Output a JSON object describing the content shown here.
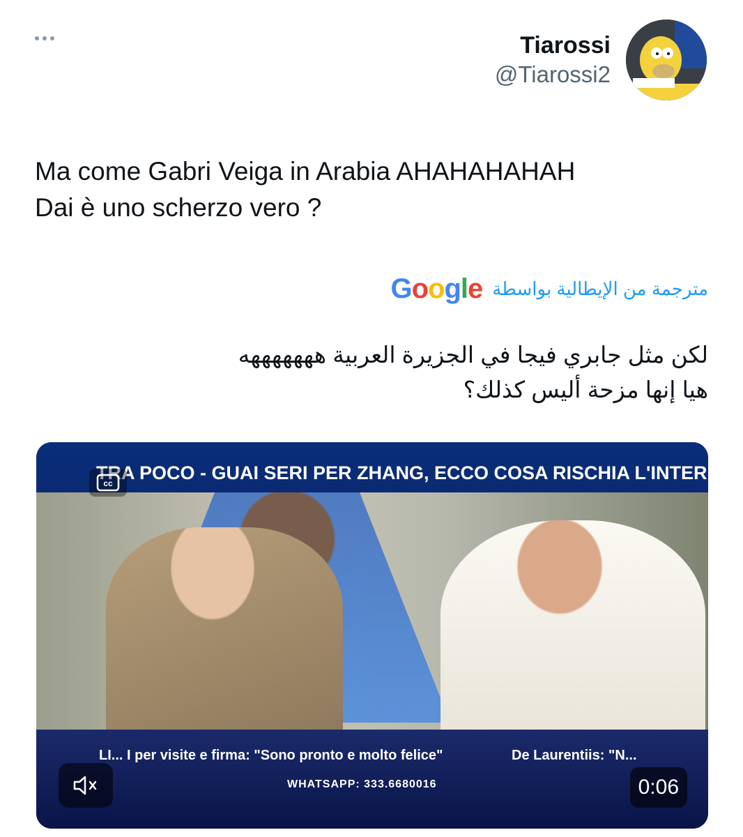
{
  "tweet": {
    "author_name": "Tiarossi",
    "author_handle": "@Tiarossi2",
    "text": "Ma come Gabri Veiga in Arabia AHAHAHAHAH\nDai è uno scherzo vero ?"
  },
  "translation": {
    "label": "مترجمة من الإيطالية بواسطة",
    "provider": "Google",
    "text": "لكن مثل جابري فيجا في الجزيرة العربية هههههههه\nهيا إنها مزحة أليس كذلك؟"
  },
  "video": {
    "ticker_top": "TRA POCO - GUAI SERI PER ZHANG, ECCO COSA RISCHIA L'INTER",
    "ticker_bottom_left": "LI... I per visite e firma: \"Sono pronto e molto felice\"",
    "ticker_bottom_right": "De Laurentiis: \"N...",
    "ticker_bottom_line2": "WHATSAPP: 333.6680016",
    "time": "0:06"
  },
  "icons": {
    "more": "more-horizontal-icon",
    "avatar": "simpsons-avatar",
    "captions": "captions-icon",
    "mute": "muted-speaker-icon"
  },
  "colors": {
    "link_blue": "#1d9bf0",
    "handle_gray": "#536471",
    "text": "#0f1419"
  }
}
